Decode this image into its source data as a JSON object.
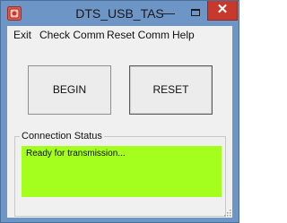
{
  "window": {
    "title": "DTS_USB_TAS",
    "minimize_glyph": "—",
    "close_glyph": "✕",
    "icons": {
      "app": "app-icon",
      "minimize": "minimize-icon",
      "maximize": "maximize-icon",
      "close": "close-icon",
      "resize": "resize-grip-icon"
    },
    "colors": {
      "title_bar": "#6d95c6",
      "close_button": "#c7382d",
      "status_background": "#a4ff1f"
    }
  },
  "menu": {
    "items": [
      {
        "label": "Exit"
      },
      {
        "label": "Check Comm"
      },
      {
        "label": "Reset Comm"
      },
      {
        "label": "Help"
      }
    ]
  },
  "buttons": {
    "begin_label": "BEGIN",
    "reset_label": "RESET"
  },
  "connection": {
    "group_label": "Connection Status",
    "status_text": "Ready for transmission..."
  }
}
